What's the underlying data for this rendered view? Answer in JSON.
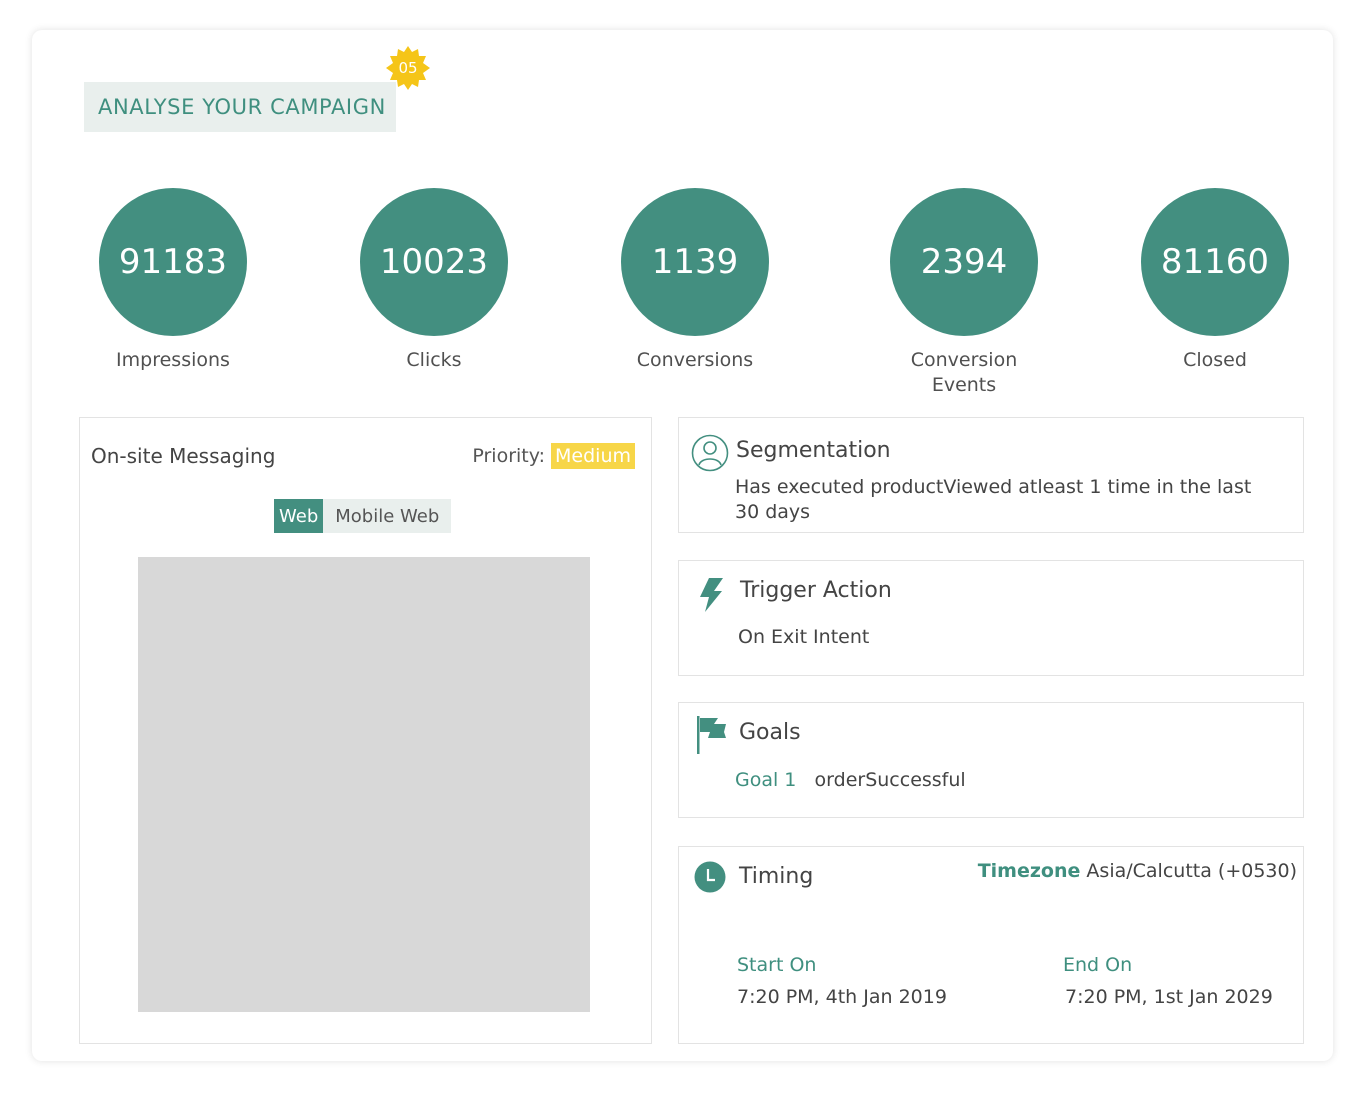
{
  "header": {
    "title": "ANALYSE YOUR CAMPAIGN",
    "step": "05"
  },
  "stats": [
    {
      "value": "91183",
      "label": "Impressions"
    },
    {
      "value": "10023",
      "label": "Clicks"
    },
    {
      "value": "1139",
      "label": "Conversions"
    },
    {
      "value": "2394",
      "label": "Conversion Events"
    },
    {
      "value": "81160",
      "label": "Closed"
    }
  ],
  "messaging": {
    "title": "On-site Messaging",
    "priority_label": "Priority:",
    "priority_value": "Medium",
    "tabs": [
      "Web",
      "Mobile Web"
    ]
  },
  "segmentation": {
    "title": "Segmentation",
    "text": "Has executed productViewed atleast 1 time in the last 30 days",
    "icon": "user-icon"
  },
  "trigger": {
    "title": "Trigger Action",
    "text": "On Exit Intent",
    "icon": "lightning-icon"
  },
  "goals": {
    "title": "Goals",
    "goal_label": "Goal 1",
    "goal_value": "orderSuccessful",
    "icon": "flag-icon"
  },
  "timing": {
    "title": "Timing",
    "timezone_label": "Timezone",
    "timezone_value": "Asia/Calcutta (+0530)",
    "start_label": "Start On",
    "start_value": "7:20 PM, 4th Jan 2019",
    "end_label": "End On",
    "end_value": "7:20 PM, 1st Jan 2029",
    "icon": "clock-icon"
  },
  "colors": {
    "accent": "#438f80",
    "badge": "#f7d648",
    "tag_bg": "#e9efed"
  }
}
